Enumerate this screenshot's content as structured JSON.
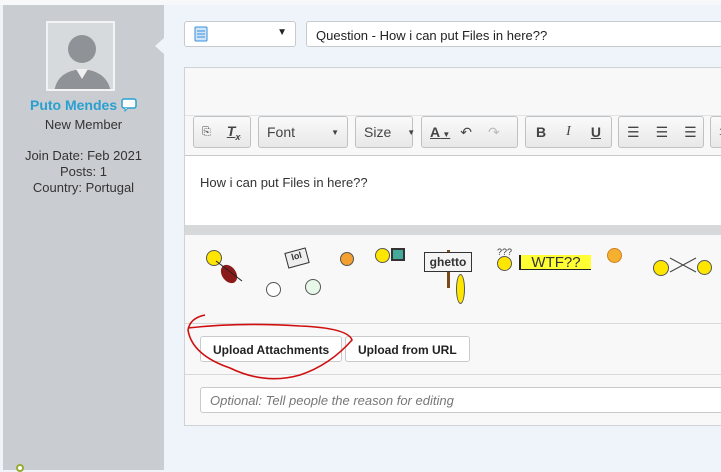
{
  "user": {
    "name": "Puto Mendes",
    "rank": "New Member",
    "join_date": "Join Date: Feb 2021",
    "posts": "Posts: 1",
    "country": "Country: Portugal"
  },
  "editor": {
    "icon_select": "▼",
    "title_value": "Question - How i can put Files in here??",
    "toolbar": {
      "font": "Font",
      "size": "Size",
      "bold": "B",
      "italic": "I",
      "underline": "U"
    },
    "body_text": "How i can put Files in here??",
    "smilies": {
      "ghetto": "ghetto",
      "wtf": "WTF??",
      "lol": "lol",
      "question_marks": "???"
    },
    "upload_attachments": "Upload Attachments",
    "upload_url": "Upload from URL",
    "reason_placeholder": "Optional: Tell people the reason for editing"
  },
  "colors": {
    "accent": "#2aa0d0",
    "annotation": "#d01010"
  }
}
